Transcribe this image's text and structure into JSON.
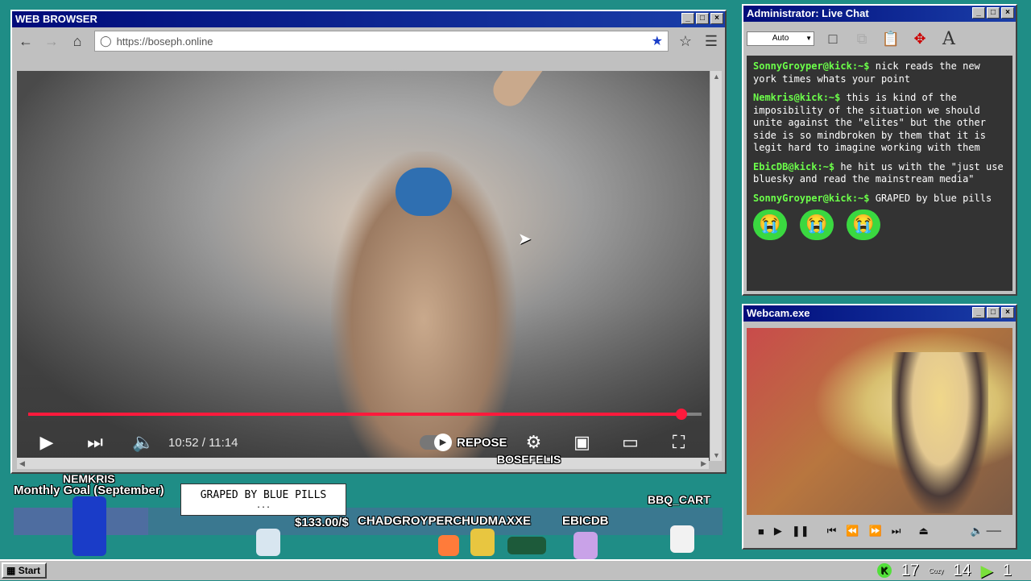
{
  "browser": {
    "title": "WEB BROWSER",
    "url": "https://boseph.online",
    "video": {
      "time_current": "10:52",
      "time_total": "11:14",
      "time_separator": "/",
      "progress_fraction": 0.97,
      "overlay_label": "REPOSE"
    }
  },
  "chat": {
    "title": "Administrator: Live Chat",
    "dropdown_value": "Auto",
    "messages": [
      {
        "user": "SonnyGroyper@kick:~$",
        "text": "nick reads the new york times whats your point"
      },
      {
        "user": "Nemkris@kick:~$",
        "text": "this is kind of the imposibility of the situation we should unite against the \"elites\" but the other side is so mindbroken by them that it is legit hard to imagine working with them"
      },
      {
        "user": "EbicDB@kick:~$",
        "text": "he hit us with the \"just use bluesky and read the mainstream media\""
      },
      {
        "user": "SonnyGroyper@kick:~$",
        "text": "GRAPED by blue pills"
      }
    ],
    "emote_glyph": "😭"
  },
  "webcam": {
    "title": "Webcam.exe"
  },
  "overlay": {
    "goal_label": "Monthly Goal (September)",
    "goal_amount": "$133.00/$",
    "goal_fraction": 0.19,
    "tooltip_text": "GRAPED BY BLUE PILLS",
    "tooltip_sub": "...",
    "names": {
      "n1": "NEMKRIS",
      "n2": "BOSEFELIS",
      "n3": "BBQ_CART",
      "n4": "CHADGROYPERCHUDMAXXE",
      "n5": "EBICDB"
    }
  },
  "taskbar": {
    "start_label": "Start",
    "stat_1": "17",
    "stat_2": "14",
    "stat_3": "1",
    "tray_label": "Cozy"
  }
}
